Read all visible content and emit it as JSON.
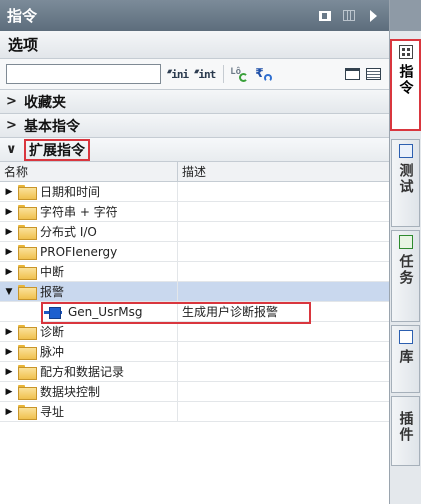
{
  "window": {
    "title": "指令"
  },
  "options": {
    "header": "选项",
    "search_value": "",
    "search_placeholder": ""
  },
  "sections": {
    "favorites": "收藏夹",
    "basic": "基本指令",
    "extended": "扩展指令"
  },
  "columns": {
    "name": "名称",
    "description": "描述"
  },
  "tree": [
    {
      "label": "日期和时间",
      "expanded": false
    },
    {
      "label": "字符串 + 字符",
      "expanded": false
    },
    {
      "label": "分布式 I/O",
      "expanded": false
    },
    {
      "label": "PROFIenergy",
      "expanded": false
    },
    {
      "label": "中断",
      "expanded": false
    },
    {
      "label": "报警",
      "expanded": true,
      "selected": true
    },
    {
      "label": "Gen_UsrMsg",
      "description": "生成用户诊断报警",
      "child": true
    },
    {
      "label": "诊断",
      "expanded": false
    },
    {
      "label": "脉冲",
      "expanded": false
    },
    {
      "label": "配方和数据记录",
      "expanded": false
    },
    {
      "label": "数据块控制",
      "expanded": false
    },
    {
      "label": "寻址",
      "expanded": false
    }
  ],
  "side_tabs": [
    {
      "label": "指令",
      "active": true,
      "icon": "instructions-icon"
    },
    {
      "label": "测试",
      "active": false,
      "icon": "testing-icon"
    },
    {
      "label": "任务",
      "active": false,
      "icon": "tasks-icon"
    },
    {
      "label": "库",
      "active": false,
      "icon": "libraries-icon"
    },
    {
      "label": "插件",
      "active": false,
      "icon": "none"
    }
  ],
  "colors": {
    "titlebar": "#6b7b8a",
    "highlight_border": "#d9363e",
    "selected_row": "#c9d8ee",
    "folder": "#efc04e",
    "block_icon": "#1d5fcf"
  }
}
